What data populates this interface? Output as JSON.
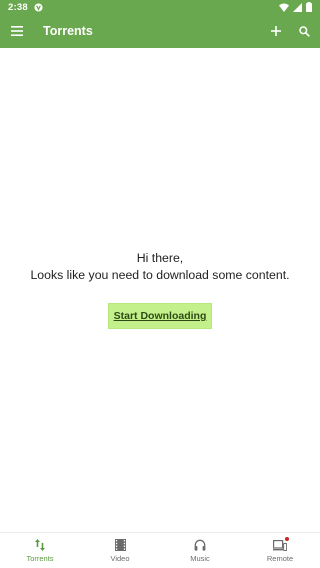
{
  "status_bar": {
    "time": "2:38"
  },
  "app_bar": {
    "title": "Torrents"
  },
  "empty_state": {
    "greeting": "Hi there,",
    "message": "Looks like you need to download some content.",
    "button_label": "Start Downloading"
  },
  "bottom_nav": {
    "items": [
      {
        "label": "Torrents",
        "icon": "swap-vert-icon",
        "active": true
      },
      {
        "label": "Video",
        "icon": "film-icon",
        "active": false
      },
      {
        "label": "Music",
        "icon": "headphones-icon",
        "active": false
      },
      {
        "label": "Remote",
        "icon": "devices-icon",
        "active": false
      }
    ]
  },
  "colors": {
    "primary": "#6aa84f",
    "accent_button": "#c3f08a",
    "nav_active": "#5b9a3f",
    "notification_dot": "#c62828"
  }
}
